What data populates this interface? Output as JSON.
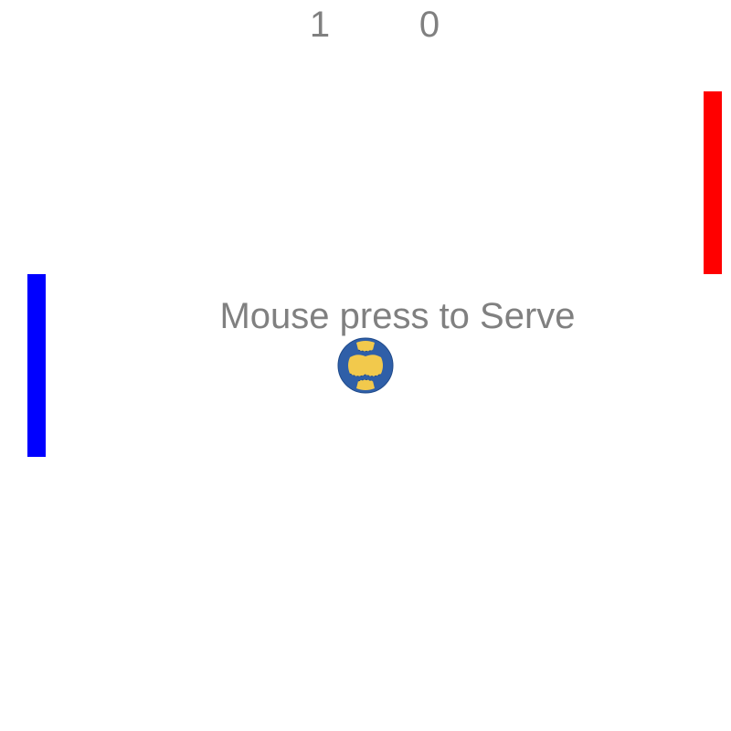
{
  "scoreboard": {
    "left_score": "1",
    "right_score": "0"
  },
  "message": {
    "serve_prompt": "Mouse press to Serve"
  },
  "paddles": {
    "left_color": "#0000ff",
    "right_color": "#ff0000"
  },
  "ball": {
    "icon": "soccer-ball-icon",
    "primary_color": "#2f5fa8",
    "secondary_color": "#f2c94c"
  },
  "colors": {
    "background": "#ffffff",
    "text": "#808080"
  }
}
